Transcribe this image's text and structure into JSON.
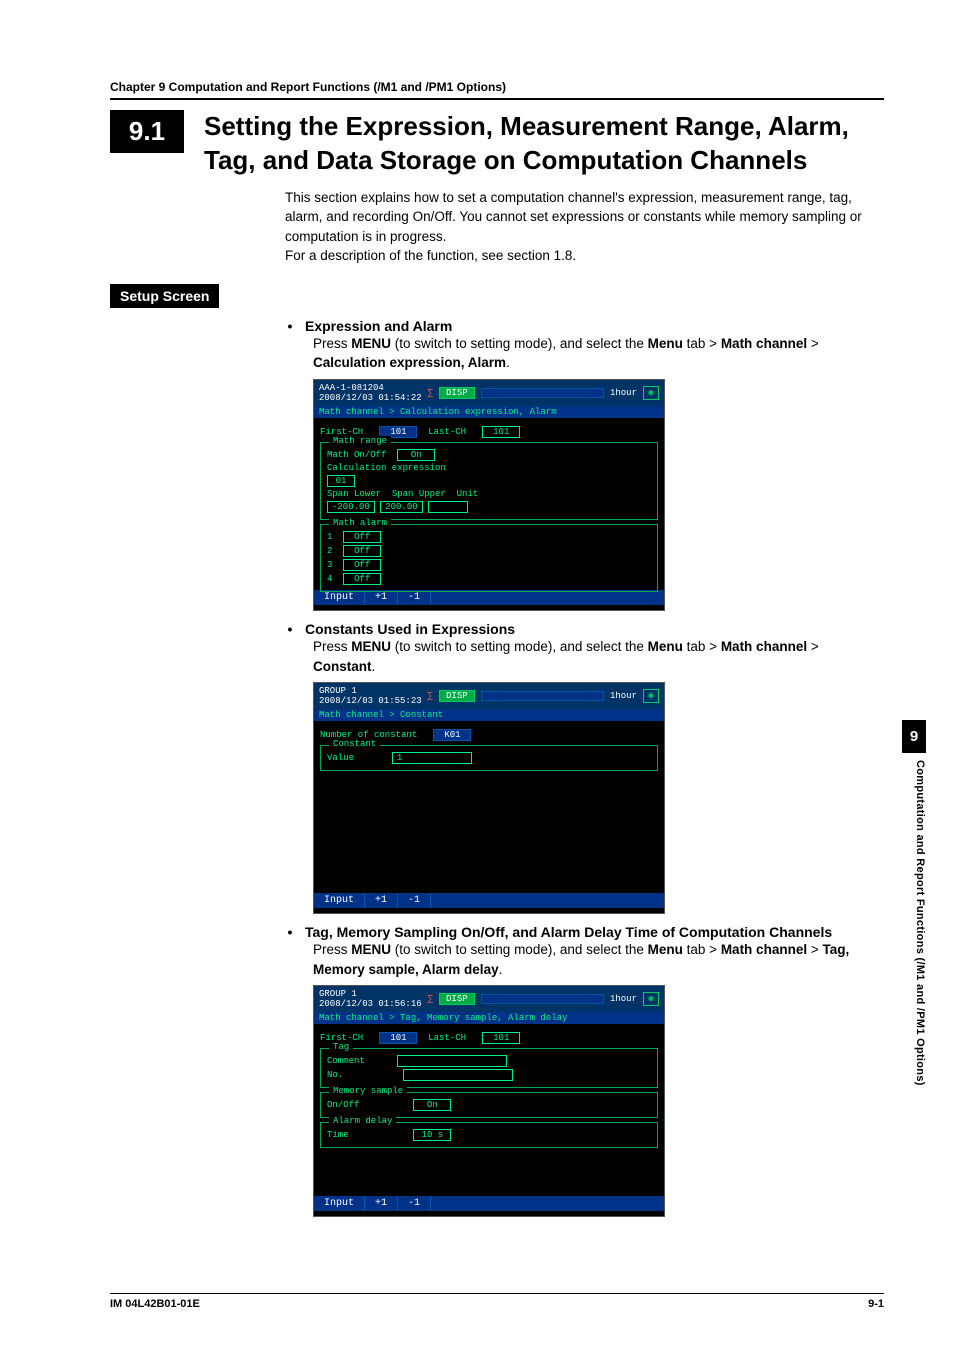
{
  "chapter_line": "Chapter 9    Computation and Report Functions (/M1 and /PM1 Options)",
  "sec_num": "9.1",
  "title": "Setting the Expression, Measurement Range, Alarm, Tag, and Data Storage on Computation Channels",
  "intro1": "This section explains how to set a computation channel's expression, measurement range, tag, alarm, and recording On/Off. You cannot set expressions or constants while memory sampling or computation is in progress.",
  "intro2": "For a description of the function, see section 1.8.",
  "setup_tab": "Setup Screen",
  "b1": {
    "title": "Expression and Alarm",
    "instr_a": "Press ",
    "menu": "MENU",
    "instr_b": " (to switch to setting mode), and select the ",
    "tab": "Menu",
    "instr_c": " tab > ",
    "math": "Math channel",
    "instr_d": " > ",
    "leaf": "Calculation expression, Alarm",
    "dot": "."
  },
  "b2": {
    "title": "Constants Used in Expressions",
    "leaf": "Constant"
  },
  "b3": {
    "title": "Tag, Memory Sampling On/Off, and Alarm Delay Time of Computation  Channels",
    "leaf": "Tag, Memory sample, Alarm delay"
  },
  "shot1": {
    "top_l1": "AAA-1-081204",
    "top_l2": "2008/12/03 01:54:22",
    "disp": "DISP",
    "hour": "1hour",
    "bread": "Math channel > Calculation expression, Alarm",
    "first": "First-CH",
    "first_v": "101",
    "last": "Last-CH",
    "last_v": "101",
    "grp1": "Math range",
    "onoff": "Math On/Off",
    "onoff_v": "On",
    "calc": "Calculation expression",
    "calc_v": "01",
    "spanl": "Span Lower",
    "spanl_v": "-200.00",
    "spanu": "Span Upper",
    "spanu_v": "200.00",
    "unit": "Unit",
    "grp2": "Math alarm",
    "a1": "1",
    "a2": "2",
    "a3": "3",
    "a4": "4",
    "off": "Off",
    "f1": "Input",
    "f2": "+1",
    "f3": "-1"
  },
  "shot2": {
    "top_l1": "GROUP 1",
    "top_l2": "2008/12/03 01:55:23",
    "bread": "Math channel > Constant",
    "num": "Number of constant",
    "num_v": "K01",
    "grp": "Constant",
    "val": "Value",
    "val_v": "1"
  },
  "shot3": {
    "top_l1": "GROUP 1",
    "top_l2": "2008/12/03 01:56:16",
    "bread": "Math channel > Tag, Memory sample, Alarm delay",
    "first": "First-CH",
    "first_v": "101",
    "last": "Last-CH",
    "last_v": "101",
    "grp1": "Tag",
    "comment": "Comment",
    "no": "No.",
    "grp2": "Memory sample",
    "onoff": "On/Off",
    "onoff_v": "On",
    "grp3": "Alarm delay",
    "time": "Time",
    "time_v": "10 s"
  },
  "side_num": "9",
  "side_text": "Computation and Report Functions (/M1 and /PM1 Options)",
  "footer_l": "IM 04L42B01-01E",
  "footer_r": "9-1"
}
